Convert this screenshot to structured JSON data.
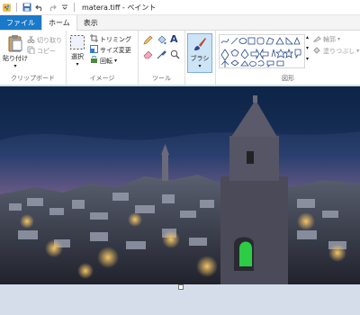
{
  "window": {
    "title": "matera.tiff - ペイント"
  },
  "tabs": [
    {
      "label": "ファイル"
    },
    {
      "label": "ホーム"
    },
    {
      "label": "表示"
    }
  ],
  "ribbon": {
    "clipboard": {
      "paste_label": "貼り付け",
      "cut_label": "切り取り",
      "copy_label": "コピー",
      "group_label": "クリップボード"
    },
    "image": {
      "select_label": "選択",
      "crop_label": "トリミング",
      "resize_label": "サイズ変更",
      "rotate_label": "回転",
      "group_label": "イメージ"
    },
    "tools": {
      "group_label": "ツール"
    },
    "brush": {
      "label": "ブラシ"
    },
    "shapes": {
      "outline_label": "輪郭",
      "fill_label": "塗りつぶし",
      "group_label": "図形"
    }
  },
  "colors": {
    "accent": "#1979ca",
    "canvas_bg": "#d4dde9",
    "sky_top": "#0e2748",
    "sunset": "#e07a52"
  },
  "icons": [
    "app-icon",
    "save-icon",
    "undo-icon",
    "redo-icon",
    "paste-icon",
    "cut-icon",
    "copy-icon",
    "select-icon",
    "crop-icon",
    "resize-icon",
    "rotate-icon",
    "pencil-icon",
    "fill-icon",
    "text-icon",
    "eraser-icon",
    "color-picker-icon",
    "magnifier-icon",
    "brush-icon"
  ]
}
